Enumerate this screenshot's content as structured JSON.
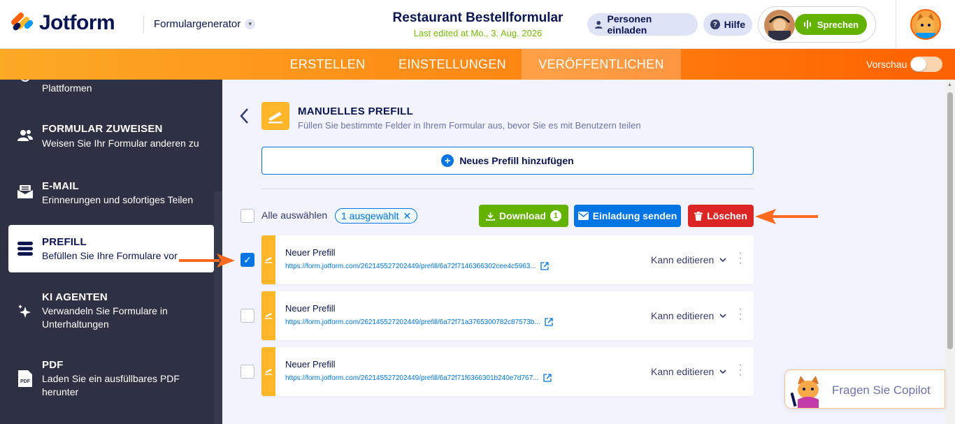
{
  "header": {
    "brand": "Jotform",
    "form_generator": "Formulargenerator",
    "form_title": "Restaurant Bestellformular",
    "last_edited": "Last edited at Mo., 3. Aug. 2026",
    "invite": "Personen einladen",
    "help": "Hilfe",
    "speak": "Sprechen"
  },
  "nav": {
    "tabs": [
      "ERSTELLEN",
      "EINSTELLUNGEN",
      "VERÖFFENTLICHEN"
    ],
    "active_tab": "VERÖFFENTLICHEN",
    "preview": "Vorschau",
    "preview_on": false
  },
  "sidebar": {
    "items": [
      {
        "title": "",
        "desc": "Plattformen"
      },
      {
        "title": "FORMULAR ZUWEISEN",
        "desc": "Weisen Sie Ihr Formular anderen zu"
      },
      {
        "title": "E-MAIL",
        "desc": "Erinnerungen und sofortiges Teilen"
      },
      {
        "title": "PREFILL",
        "desc": "Befüllen Sie Ihre Formulare vor",
        "active": true
      },
      {
        "title": "KI AGENTEN",
        "desc": "Verwandeln Sie Formulare in Unterhaltungen"
      },
      {
        "title": "PDF",
        "desc": "Laden Sie ein ausfüllbares PDF herunter"
      }
    ]
  },
  "section": {
    "title": "MANUELLES PREFILL",
    "desc": "Füllen Sie bestimmte Felder in Ihrem Formular aus, bevor Sie es mit Benutzern teilen",
    "add_button": "Neues Prefill hinzufügen"
  },
  "toolbar": {
    "select_all": "Alle auswählen",
    "selected_pill": "1 ausgewählt",
    "download": "Download",
    "download_count": "1",
    "send_invite": "Einladung senden",
    "delete": "Löschen"
  },
  "prefills": [
    {
      "name": "Neuer Prefill",
      "url": "https://form.jotform.com/262145527202449/prefill/6a72f7146366302cee4c5963...",
      "permission": "Kann editieren",
      "checked": true
    },
    {
      "name": "Neuer Prefill",
      "url": "https://form.jotform.com/262145527202449/prefill/6a72f71a3765300782c87573b...",
      "permission": "Kann editieren",
      "checked": false
    },
    {
      "name": "Neuer Prefill",
      "url": "https://form.jotform.com/262145527202449/prefill/6a72f71f6366301b240e7d767...",
      "permission": "Kann editieren",
      "checked": false
    }
  ],
  "copilot": {
    "label": "Fragen Sie Copilot"
  },
  "colors": {
    "orange": "#ff6100",
    "green": "#64b200",
    "blue": "#0075e3",
    "red": "#dc2626",
    "sidebar": "#2d3143",
    "prefill_accent": "#ffb629"
  }
}
